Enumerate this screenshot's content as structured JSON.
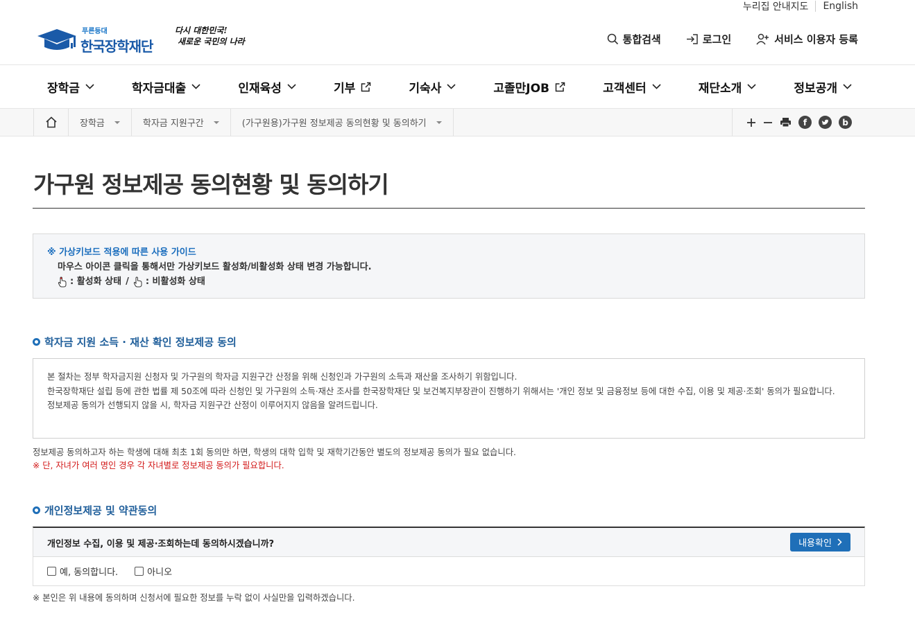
{
  "util": {
    "sitemap": "누리집 안내지도",
    "english": "English"
  },
  "logo": {
    "small": "푸른등대",
    "name": "한국장학재단"
  },
  "slogan": {
    "line1": "다시 대한민국!",
    "line2": "새로운 국민의 나라"
  },
  "header_menu": [
    {
      "label": "통합검색",
      "icon": "search-icon"
    },
    {
      "label": "로그인",
      "icon": "login-icon"
    },
    {
      "label": "서비스 이용자 등록",
      "icon": "user-add-icon"
    }
  ],
  "gnb": [
    {
      "label": "장학금",
      "icon": "chevron-down-icon"
    },
    {
      "label": "학자금대출",
      "icon": "chevron-down-icon"
    },
    {
      "label": "인재육성",
      "icon": "chevron-down-icon"
    },
    {
      "label": "기부",
      "icon": "external-link-icon"
    },
    {
      "label": "기숙사",
      "icon": "chevron-down-icon"
    },
    {
      "label": "고졸만JOB",
      "icon": "external-link-icon"
    },
    {
      "label": "고객센터",
      "icon": "chevron-down-icon"
    },
    {
      "label": "재단소개",
      "icon": "chevron-down-icon"
    },
    {
      "label": "정보공개",
      "icon": "chevron-down-icon"
    }
  ],
  "breadcrumb": [
    "장학금",
    "학자금 지원구간",
    "(가구원용)가구원 정보제공 동의현황 및 동의하기"
  ],
  "page_title": "가구원 정보제공 동의현황 및 동의하기",
  "guide": {
    "title": "※ 가상키보드 적용에 따른 사용 가이드",
    "line1": "마우스 아이콘 클릭을 통해서만 가상키보드 활성화/비활성화 상태 변경 가능합니다.",
    "active": ": 활성화 상태",
    "slash": "/",
    "inactive": ": 비활성화 상태"
  },
  "section1": {
    "title": "학자금 지원 소득 · 재산 확인 정보제공 동의",
    "p1": "본 절차는 정부 학자금지원 신청자 및 가구원의 학자금 지원구간 산정을 위해 신청인과 가구원의 소득과 재산을 조사하기 위함입니다.",
    "p2": "한국장학재단 설립 등에 관한 법률 제 50조에 따라 신청인 및 가구원의 소득·재산 조사를 한국장학재단 및 보건복지부장관이 진행하기 위해서는 '개인 정보 및 금융정보 등에 대한 수집, 이용 및 제공·조회' 동의가 필요합니다.",
    "p3": "정보제공 동의가 선행되지 않을 시, 학자금 지원구간 산정이 이루어지지 않음을 알려드립니다.",
    "note": "정보제공 동의하고자 하는 학생에 대해 최초 1회 동의만 하면, 학생의 대학 입학 및 재학기간동안 별도의 정보제공 동의가 필요 없습니다.",
    "note_red": "※ 단, 자녀가 여러 명인 경우 각 자녀별로 정보제공 동의가 필요합니다."
  },
  "section2": {
    "title": "개인정보제공 및 약관동의",
    "question": "개인정보 수집, 이용 및 제공·조회하는데 동의하시겠습니까?",
    "button": "내용확인",
    "yes": "예, 동의합니다.",
    "no": "아니오",
    "footnote": "※ 본인은 위 내용에 동의하며 신청서에 필요한 정보를 누락 없이 사실만을 입력하겠습니다."
  },
  "colors": {
    "brand": "#1a5aa8",
    "accent": "#1f6fb8",
    "warning": "#d21818"
  }
}
